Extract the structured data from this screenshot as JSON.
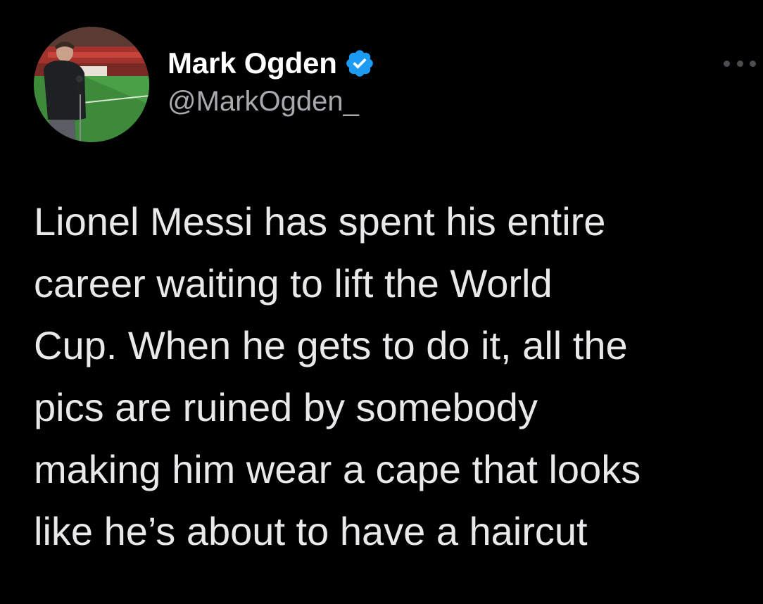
{
  "author": {
    "display_name": "Mark Ogden",
    "handle": "@MarkOgden_",
    "verified": true,
    "avatar": "profile-photo-stadium"
  },
  "more_menu": {
    "icon": "more-horizontal-icon"
  },
  "tweet": {
    "text": "Lionel Messi has spent his entire\ncareer waiting to lift the World\nCup. When he gets to do it, all the\npics are ruined by somebody\nmaking him wear a cape that looks\nlike he’s about to have a haircut"
  },
  "colors": {
    "background": "#000000",
    "name": "#ffffff",
    "handle": "#a7a9ac",
    "text": "#e7e9ea",
    "verified_badge": "#1d9bf0"
  }
}
